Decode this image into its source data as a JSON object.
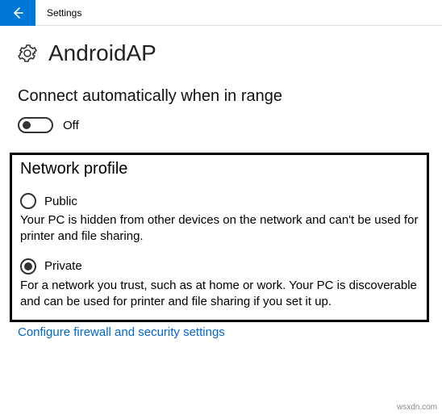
{
  "titlebar": {
    "title": "Settings"
  },
  "network": {
    "name": "AndroidAP"
  },
  "autoconnect": {
    "heading": "Connect automatically when in range",
    "toggle_state": "Off"
  },
  "profile": {
    "title": "Network profile",
    "public": {
      "label": "Public",
      "desc": "Your PC is hidden from other devices on the network and can't be used for printer and file sharing.",
      "selected": false
    },
    "private": {
      "label": "Private",
      "desc": "For a network you trust, such as at home or work. Your PC is discoverable and can be used for printer and file sharing if you set it up.",
      "selected": true
    }
  },
  "link": {
    "firewall": "Configure firewall and security settings"
  },
  "watermark": "wsxdn.com"
}
